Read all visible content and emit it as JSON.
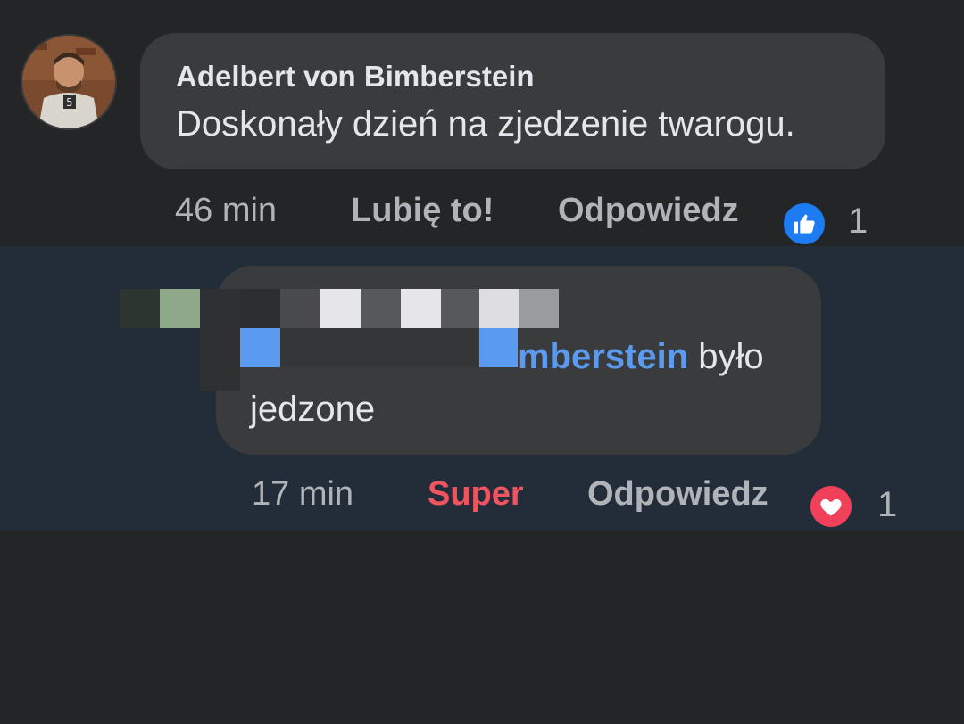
{
  "comment": {
    "author": "Adelbert von Bimberstein",
    "text": "Doskonały dzień na zjedzenie twarogu.",
    "time": "46 min",
    "like_label": "Lubię to!",
    "reply_label": "Odpowiedz",
    "reaction_icon": "like-icon",
    "reaction_count": "1"
  },
  "reply": {
    "mention_visible": "mberstein",
    "text_after_mention": " było",
    "text_line2": "jedzone",
    "time": "17 min",
    "reaction_label": "Super",
    "reply_label": "Odpowiedz",
    "reaction_icon": "heart-icon",
    "reaction_count": "1"
  },
  "colors": {
    "background": "#242526",
    "reply_background": "#232c39",
    "bubble": "#3a3b3c",
    "mention": "#5a9bf1",
    "super": "#f0545e",
    "like_blue": "#1d7cf2"
  }
}
